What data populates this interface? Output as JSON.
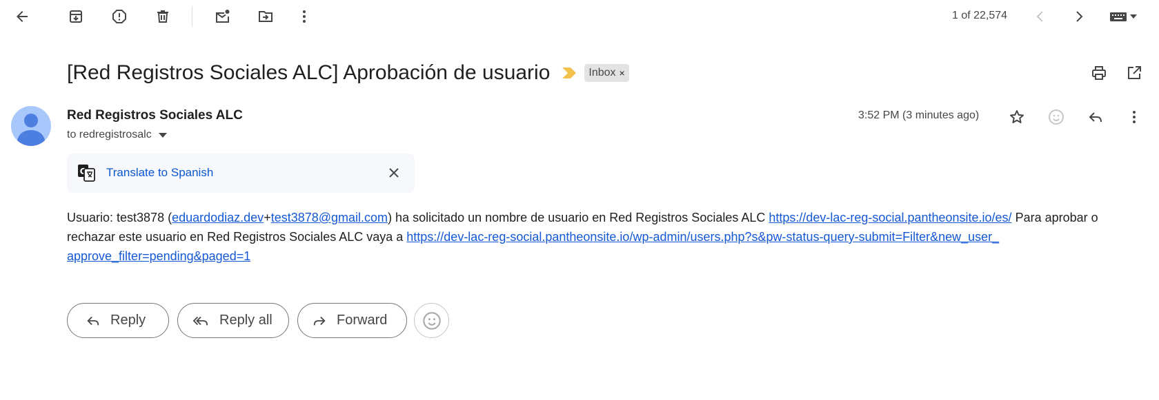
{
  "toolbar": {
    "pager_text": "1 of 22,574"
  },
  "message": {
    "subject": "[Red Registros Sociales ALC] Aprobación de usuario",
    "label": "Inbox",
    "label_remove": "×",
    "sender_name": "Red Registros Sociales ALC",
    "recipient": "to redregistrosalc",
    "timestamp": "3:52 PM (3 minutes ago)"
  },
  "translate": {
    "label": "Translate to Spanish"
  },
  "body": {
    "p1": "Usuario: test3878 (",
    "email_part1": "eduardodiaz.dev",
    "plus": "+",
    "email_part2": "test3878@gmail.com",
    "p2": ") ha solicitado un nombre de usuario en Red Registros Sociales ALC ",
    "link1": "https://dev-lac-reg-social.pantheonsite.io/es/",
    "p3": " Para aprobar o",
    "p4": "rechazar este usuario en Red Registros Sociales ALC vaya a ",
    "link2_line1": "https://dev-lac-reg-social.pantheonsite.io/wp-admin/users.php?s&pw-status-query-submit=Filter&new_user_",
    "link2_line2": "approve_filter=pending&paged=1"
  },
  "actions": {
    "reply": "Reply",
    "reply_all": "Reply all",
    "forward": "Forward"
  },
  "colors": {
    "accent_link": "#0b57d0",
    "avatar_bg": "#a8c7fa",
    "avatar_fg": "#4c7fe0",
    "importance": "#f2c14e",
    "chip_bg": "#e3e3e3"
  }
}
